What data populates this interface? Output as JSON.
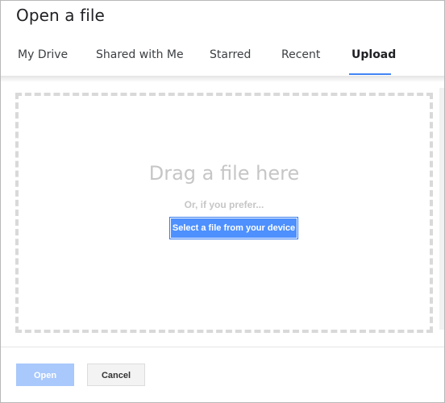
{
  "dialog": {
    "title": "Open a file"
  },
  "tabs": [
    {
      "label": "My Drive",
      "active": false
    },
    {
      "label": "Shared with Me",
      "active": false
    },
    {
      "label": "Starred",
      "active": false
    },
    {
      "label": "Recent",
      "active": false
    },
    {
      "label": "Upload",
      "active": true
    }
  ],
  "upload": {
    "drag_text": "Drag a file here",
    "prefer_text": "Or, if you prefer...",
    "select_button_label": "Select a file from your device"
  },
  "footer": {
    "open_label": "Open",
    "cancel_label": "Cancel",
    "open_enabled": false
  },
  "colors": {
    "accent": "#4285f4",
    "select_button_bg": "#4d90fe",
    "open_disabled_bg": "#a9c8fb",
    "placeholder_text": "#c6c6c6"
  }
}
